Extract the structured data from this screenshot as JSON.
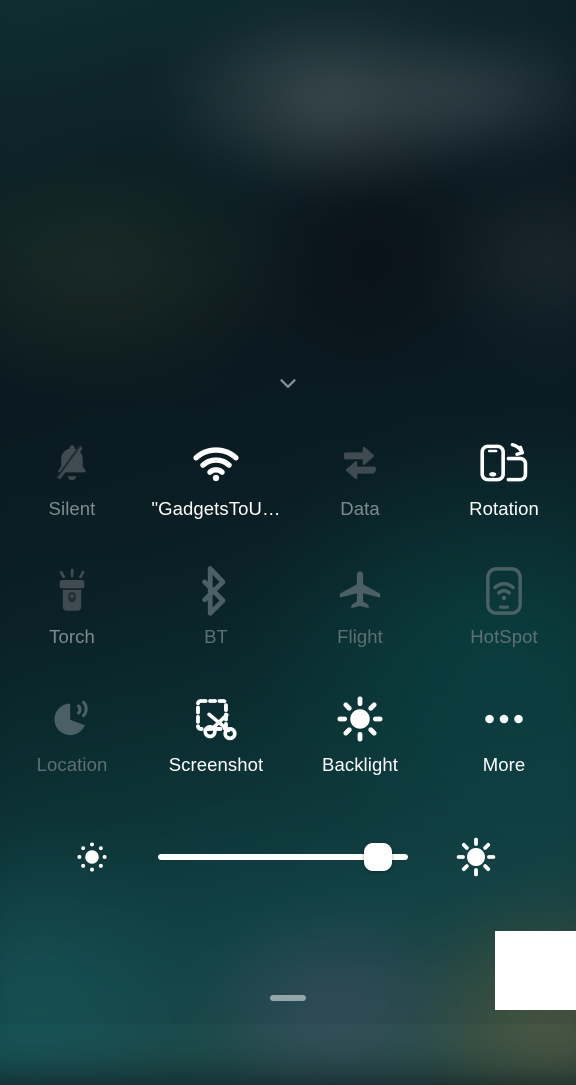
{
  "panel": {
    "name": "quick-settings-panel",
    "collapse_hint": "chevron-down-icon",
    "brightness": {
      "value": 93,
      "min": 0,
      "max": 100,
      "low_icon": "sun-small-icon",
      "high_icon": "sun-large-icon"
    }
  },
  "accents": {
    "active_text": "#ffffff",
    "inactive_text": "#7e8b8e",
    "dim_text": "#5d7073",
    "slider_fill": "#ffffff",
    "panel_bg": "#0d1a1f"
  },
  "toggles": [
    {
      "label": "Silent",
      "icon": "bell-slash-icon",
      "state": "off"
    },
    {
      "label": "\"GadgetsToU…",
      "icon": "wifi-icon",
      "state": "on"
    },
    {
      "label": "Data",
      "icon": "data-transfer-icon",
      "state": "off"
    },
    {
      "label": "Rotation",
      "icon": "screen-rotation-icon",
      "state": "on"
    },
    {
      "label": "Torch",
      "icon": "flashlight-icon",
      "state": "off"
    },
    {
      "label": "BT",
      "icon": "bluetooth-icon",
      "state": "dim"
    },
    {
      "label": "Flight",
      "icon": "airplane-icon",
      "state": "dim"
    },
    {
      "label": "HotSpot",
      "icon": "hotspot-icon",
      "state": "dim"
    },
    {
      "label": "Location",
      "icon": "location-waves-icon",
      "state": "dim"
    },
    {
      "label": "Screenshot",
      "icon": "scissors-crop-icon",
      "state": "on"
    },
    {
      "label": "Backlight",
      "icon": "sun-icon",
      "state": "on"
    },
    {
      "label": "More",
      "icon": "ellipsis-icon",
      "state": "on"
    }
  ],
  "bottom": {
    "home_indicator": "home-indicator-pill",
    "overlay_card": "white-overlay-card"
  }
}
